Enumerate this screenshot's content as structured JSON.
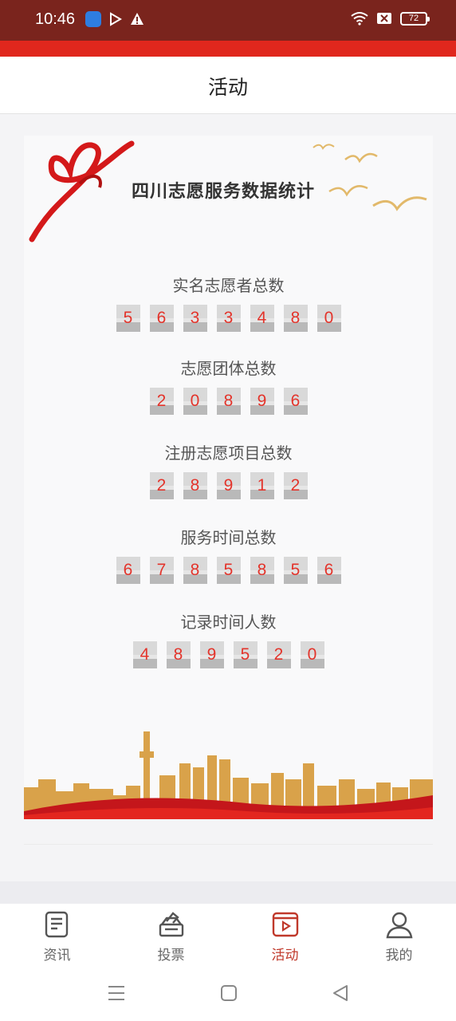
{
  "status": {
    "time": "10:46",
    "battery": "72"
  },
  "header": {
    "title": "活动"
  },
  "banner": {
    "title": "四川志愿服务数据统计"
  },
  "stats": [
    {
      "label": "实名志愿者总数",
      "digits": [
        "5",
        "6",
        "3",
        "3",
        "4",
        "8",
        "0"
      ]
    },
    {
      "label": "志愿团体总数",
      "digits": [
        "2",
        "0",
        "8",
        "9",
        "6"
      ]
    },
    {
      "label": "注册志愿项目总数",
      "digits": [
        "2",
        "8",
        "9",
        "1",
        "2"
      ]
    },
    {
      "label": "服务时间总数",
      "digits": [
        "6",
        "7",
        "8",
        "5",
        "8",
        "5",
        "6"
      ]
    },
    {
      "label": "记录时间人数",
      "digits": [
        "4",
        "8",
        "9",
        "5",
        "2",
        "0"
      ]
    }
  ],
  "nav": {
    "items": [
      {
        "label": "资讯",
        "icon": "news-icon"
      },
      {
        "label": "投票",
        "icon": "vote-icon"
      },
      {
        "label": "活动",
        "icon": "activity-video-icon",
        "active": true
      },
      {
        "label": "我的",
        "icon": "profile-icon"
      }
    ]
  },
  "colors": {
    "status_bar": "#7a241d",
    "accent_red": "#e0271d",
    "active_nav": "#c0392b",
    "digit_text": "#e3342b"
  }
}
